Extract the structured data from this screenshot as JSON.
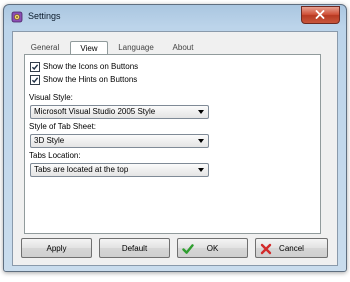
{
  "window": {
    "title": "Settings"
  },
  "tabs": [
    {
      "label": "General"
    },
    {
      "label": "View"
    },
    {
      "label": "Language"
    },
    {
      "label": "About"
    }
  ],
  "options": {
    "show_icons": {
      "label": "Show the Icons on Buttons",
      "checked": true
    },
    "show_hints": {
      "label": "Show the Hints on Buttons",
      "checked": true
    }
  },
  "visual_style": {
    "label": "Visual Style:",
    "value": "Microsoft Visual Studio 2005 Style"
  },
  "tab_sheet_style": {
    "label": "Style of Tab Sheet:",
    "value": "3D Style"
  },
  "tabs_location": {
    "label": "Tabs Location:",
    "value": "Tabs are located at the top"
  },
  "buttons": {
    "apply": "Apply",
    "default": "Default",
    "ok": "OK",
    "cancel": "Cancel"
  },
  "icons": {
    "app": "settings-app-icon",
    "close": "close-icon",
    "ok": "green-check-icon",
    "cancel": "red-x-icon"
  },
  "colors": {
    "titlebar": "#bcd4ea",
    "close_button": "#cf4f36",
    "ok_check": "#2f9e2f",
    "cancel_x": "#d22b2b"
  }
}
